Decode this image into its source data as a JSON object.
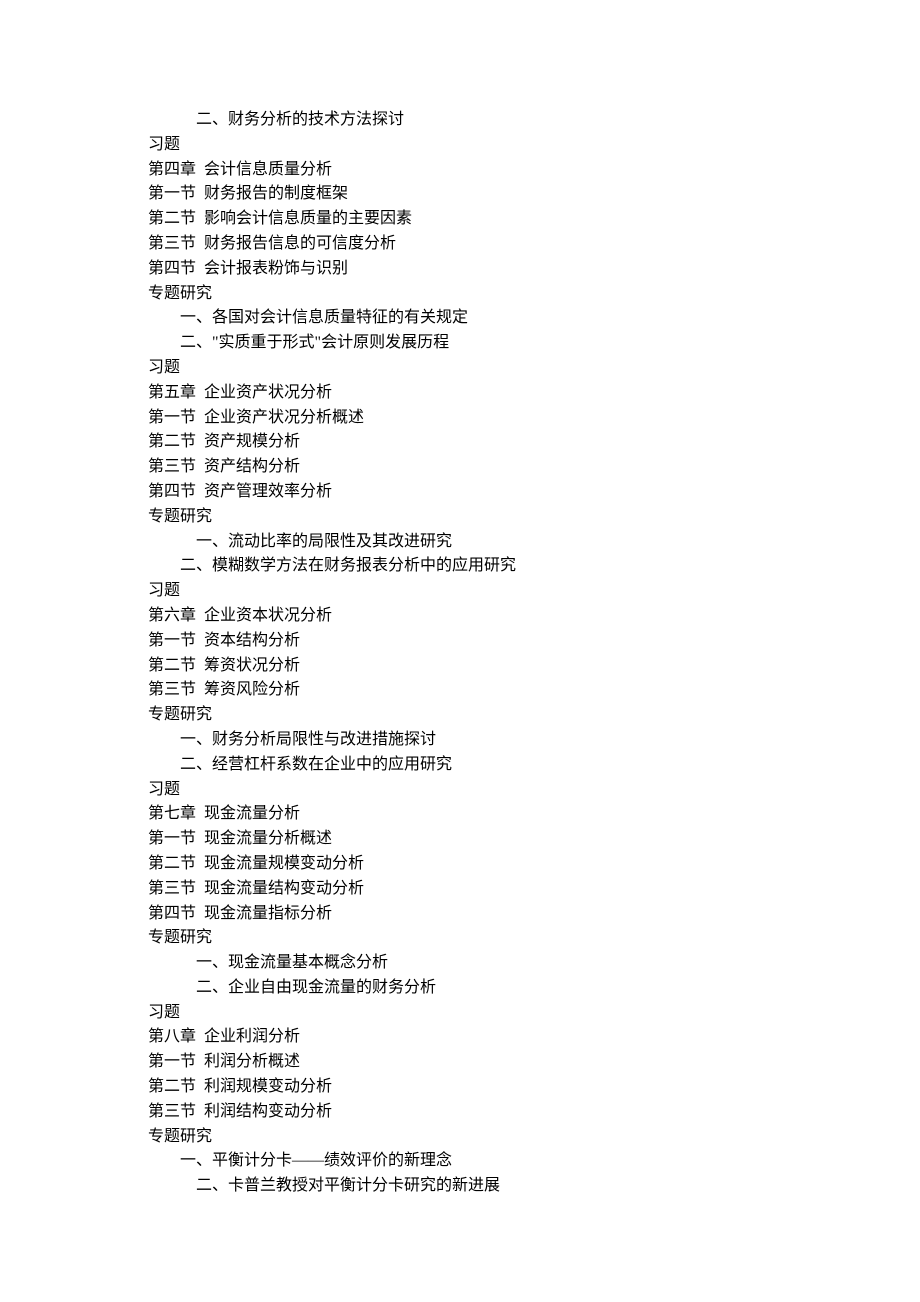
{
  "lines": [
    {
      "text": "二、财务分析的技术方法探讨",
      "indent": 2
    },
    {
      "text": "习题",
      "indent": 0
    },
    {
      "text": "第四章  会计信息质量分析",
      "indent": 0
    },
    {
      "text": "第一节  财务报告的制度框架",
      "indent": 0
    },
    {
      "text": "第二节  影响会计信息质量的主要因素",
      "indent": 0
    },
    {
      "text": "第三节  财务报告信息的可信度分析",
      "indent": 0
    },
    {
      "text": "第四节  会计报表粉饰与识别",
      "indent": 0
    },
    {
      "text": "专题研究",
      "indent": 0
    },
    {
      "text": "一、各国对会计信息质量特征的有关规定",
      "indent": 1
    },
    {
      "text": "二、\"实质重于形式\"会计原则发展历程",
      "indent": 1
    },
    {
      "text": "习题",
      "indent": 0
    },
    {
      "text": "第五章  企业资产状况分析",
      "indent": 0
    },
    {
      "text": "第一节  企业资产状况分析概述",
      "indent": 0
    },
    {
      "text": "第二节  资产规模分析",
      "indent": 0
    },
    {
      "text": "第三节  资产结构分析",
      "indent": 0
    },
    {
      "text": "第四节  资产管理效率分析",
      "indent": 0
    },
    {
      "text": "专题研究",
      "indent": 0
    },
    {
      "text": "一、流动比率的局限性及其改进研究",
      "indent": 2
    },
    {
      "text": "二、模糊数学方法在财务报表分析中的应用研究",
      "indent": 1
    },
    {
      "text": "习题",
      "indent": 0
    },
    {
      "text": "第六章  企业资本状况分析",
      "indent": 0
    },
    {
      "text": "第一节  资本结构分析",
      "indent": 0
    },
    {
      "text": "第二节  筹资状况分析",
      "indent": 0
    },
    {
      "text": "第三节  筹资风险分析",
      "indent": 0
    },
    {
      "text": "专题研究",
      "indent": 0
    },
    {
      "text": "一、财务分析局限性与改进措施探讨",
      "indent": 1
    },
    {
      "text": "二、经营杠杆系数在企业中的应用研究",
      "indent": 1
    },
    {
      "text": "习题",
      "indent": 0
    },
    {
      "text": "第七章  现金流量分析",
      "indent": 0
    },
    {
      "text": "第一节  现金流量分析概述",
      "indent": 0
    },
    {
      "text": "第二节  现金流量规模变动分析",
      "indent": 0
    },
    {
      "text": "第三节  现金流量结构变动分析",
      "indent": 0
    },
    {
      "text": "第四节  现金流量指标分析",
      "indent": 0
    },
    {
      "text": "专题研究",
      "indent": 0
    },
    {
      "text": "一、现金流量基本概念分析",
      "indent": 2
    },
    {
      "text": "二、企业自由现金流量的财务分析",
      "indent": 2
    },
    {
      "text": "习题",
      "indent": 0
    },
    {
      "text": "第八章  企业利润分析",
      "indent": 0
    },
    {
      "text": "第一节  利润分析概述",
      "indent": 0
    },
    {
      "text": "第二节  利润规模变动分析",
      "indent": 0
    },
    {
      "text": "第三节  利润结构变动分析",
      "indent": 0
    },
    {
      "text": "专题研究",
      "indent": 0
    },
    {
      "text": "一、平衡计分卡——绩效评价的新理念",
      "indent": 1
    },
    {
      "text": "二、卡普兰教授对平衡计分卡研究的新进展",
      "indent": 2
    }
  ]
}
